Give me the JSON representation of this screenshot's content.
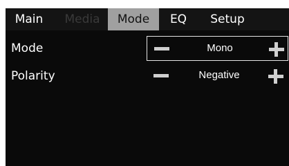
{
  "tabs": {
    "main": "Main",
    "media": "Media",
    "mode": "Mode",
    "eq": "EQ",
    "setup": "Setup",
    "active": "mode",
    "disabled": [
      "media"
    ]
  },
  "params": {
    "mode": {
      "label": "Mode",
      "value": "Mono",
      "selected": true
    },
    "polarity": {
      "label": "Polarity",
      "value": "Negative",
      "selected": false
    }
  },
  "colors": {
    "panel_bg": "#0a0a0a",
    "active_tab_bg": "#a0a0a0",
    "disabled_tab_text": "#3a3a3a",
    "control_glyph": "#cfcfcf"
  },
  "icons": {
    "decrease": "minus-icon",
    "increase": "plus-icon"
  }
}
